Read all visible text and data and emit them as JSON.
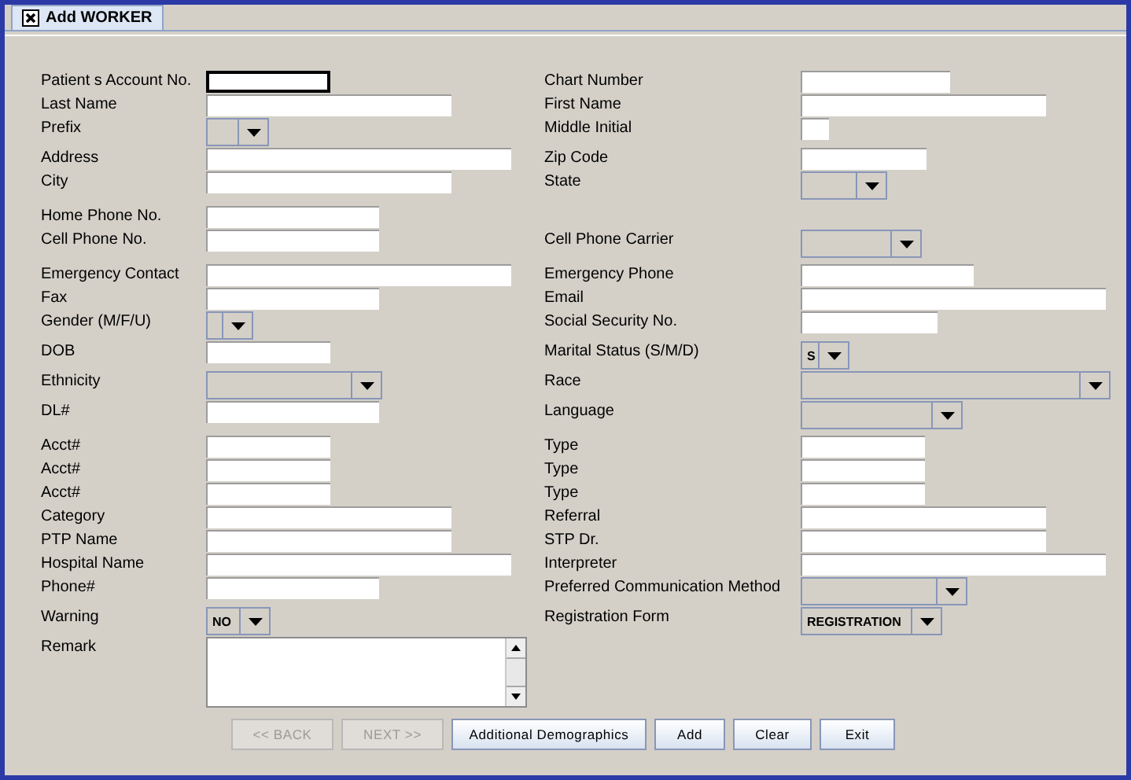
{
  "tab": {
    "label": "Add WORKER",
    "selected": true
  },
  "rows": [
    {
      "left": {
        "label": "Patient s Account No.",
        "field": {
          "kind": "text",
          "focused": true
        }
      },
      "right": {
        "label": "Chart Number",
        "field": {
          "kind": "text",
          "focused": false
        }
      }
    },
    {
      "left": {
        "label": "Last Name",
        "field": {
          "kind": "text",
          "focused": false
        }
      },
      "right": {
        "label": "First Name",
        "field": {
          "kind": "text",
          "focused": false
        }
      }
    },
    {
      "left": {
        "label": "Prefix",
        "field": {
          "kind": "combo"
        }
      },
      "right": {
        "label": "Middle Initial",
        "field": {
          "kind": "text",
          "focused": false
        }
      }
    },
    {
      "left": {
        "label": "Address",
        "field": {
          "kind": "text",
          "focused": false
        }
      },
      "right": {
        "label": "Zip Code",
        "field": {
          "kind": "text",
          "focused": false
        }
      }
    },
    {
      "left": {
        "label": "City",
        "field": {
          "kind": "text",
          "focused": false
        }
      },
      "right": {
        "label": "State",
        "field": {
          "kind": "combo"
        }
      }
    },
    {
      "left": {
        "label": "Home Phone No.",
        "field": {
          "kind": "text",
          "focused": false
        }
      }
    },
    {
      "left": {
        "label": "Cell Phone No.",
        "field": {
          "kind": "text",
          "focused": false
        }
      },
      "right": {
        "label": "Cell Phone Carrier",
        "field": {
          "kind": "combo"
        }
      }
    },
    {
      "left": {
        "label": "Emergency Contact",
        "field": {
          "kind": "text",
          "focused": false
        }
      },
      "right": {
        "label": "Emergency Phone",
        "field": {
          "kind": "text",
          "focused": false
        }
      }
    },
    {
      "left": {
        "label": "Fax",
        "field": {
          "kind": "text",
          "focused": false
        }
      },
      "right": {
        "label": "Email",
        "field": {
          "kind": "text",
          "focused": false
        }
      }
    },
    {
      "left": {
        "label": "Gender (M/F/U)",
        "field": {
          "kind": "combo"
        }
      },
      "right": {
        "label": "Social Security No.",
        "field": {
          "kind": "text",
          "focused": false
        }
      }
    },
    {
      "left": {
        "label": "DOB",
        "field": {
          "kind": "text",
          "focused": false
        }
      },
      "right": {
        "label": "Marital Status (S/M/D)",
        "field": {
          "kind": "combo",
          "value": "S"
        }
      }
    },
    {
      "left": {
        "label": "Ethnicity",
        "field": {
          "kind": "combo"
        }
      },
      "right": {
        "label": "Race",
        "field": {
          "kind": "combo"
        }
      }
    },
    {
      "left": {
        "label": "DL#",
        "field": {
          "kind": "text",
          "focused": false
        }
      },
      "right": {
        "label": "Language",
        "field": {
          "kind": "combo"
        }
      }
    },
    {
      "left": {
        "label": "Acct#",
        "field": {
          "kind": "text",
          "focused": false
        }
      },
      "right": {
        "label": "Type",
        "field": {
          "kind": "text",
          "focused": false
        }
      }
    },
    {
      "left": {
        "label": "Acct#",
        "field": {
          "kind": "text",
          "focused": false
        }
      },
      "right": {
        "label": "Type",
        "field": {
          "kind": "text",
          "focused": false
        }
      }
    },
    {
      "left": {
        "label": "Acct#",
        "field": {
          "kind": "text",
          "focused": false
        }
      },
      "right": {
        "label": "Type",
        "field": {
          "kind": "text",
          "focused": false
        }
      }
    },
    {
      "left": {
        "label": "Category",
        "field": {
          "kind": "text",
          "focused": false
        }
      },
      "right": {
        "label": "Referral",
        "field": {
          "kind": "text",
          "focused": false
        }
      }
    },
    {
      "left": {
        "label": "PTP Name",
        "field": {
          "kind": "text",
          "focused": false
        }
      },
      "right": {
        "label": "STP Dr.",
        "field": {
          "kind": "text",
          "focused": false
        }
      }
    },
    {
      "left": {
        "label": "Hospital Name",
        "field": {
          "kind": "text",
          "focused": false
        }
      },
      "right": {
        "label": "Interpreter",
        "field": {
          "kind": "text",
          "focused": false
        }
      }
    },
    {
      "left": {
        "label": "Phone#",
        "field": {
          "kind": "text",
          "focused": false
        }
      },
      "right": {
        "label": "Preferred Communication Method",
        "field": {
          "kind": "combo"
        }
      }
    },
    {
      "left": {
        "label": "Warning",
        "field": {
          "kind": "combo",
          "value": "NO"
        }
      },
      "right": {
        "label": "Registration Form",
        "field": {
          "kind": "combo",
          "value": "REGISTRATION"
        }
      }
    },
    {
      "left": {
        "label": "Remark",
        "field": {
          "kind": "textarea"
        }
      }
    }
  ],
  "buttons": [
    {
      "label": "<< BACK",
      "disabled": true
    },
    {
      "label": "NEXT >>",
      "disabled": true
    },
    {
      "label": "Additional Demographics",
      "disabled": false
    },
    {
      "label": "Add",
      "disabled": false
    },
    {
      "label": "Clear",
      "disabled": false
    },
    {
      "label": "Exit",
      "disabled": false
    }
  ]
}
